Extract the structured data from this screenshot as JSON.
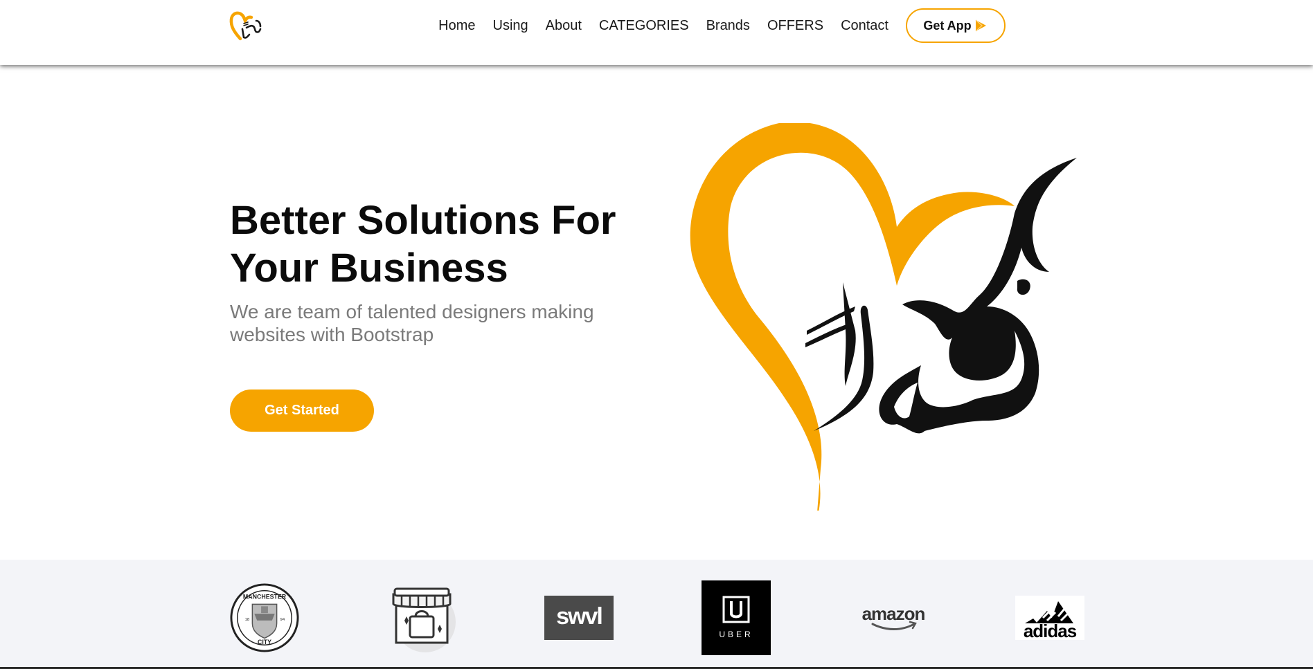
{
  "header": {
    "logo_icon": "heart-calligraphy-logo",
    "nav": [
      {
        "label": "Home"
      },
      {
        "label": "Using"
      },
      {
        "label": "About"
      },
      {
        "label": "CATEGORIES"
      },
      {
        "label": "Brands"
      },
      {
        "label": "OFFERS"
      },
      {
        "label": "Contact"
      }
    ],
    "get_app_label": "Get App",
    "get_app_icon": "play-store-icon"
  },
  "hero": {
    "title": "Better Solutions For Your Business",
    "subtitle": "We are team of talented designers making websites with Bootstrap",
    "cta_label": "Get Started",
    "art_icon": "heart-shukran-calligraphy"
  },
  "clients": {
    "logos": [
      {
        "name": "manchester-city-logo",
        "text_top": "MANCHESTER",
        "text_bottom": "CITY"
      },
      {
        "name": "shop-bag-icon"
      },
      {
        "name": "swvl-logo",
        "text": "swvl"
      },
      {
        "name": "uber-logo",
        "text": "UBER"
      },
      {
        "name": "amazon-logo",
        "text": "amazon"
      },
      {
        "name": "adidas-logo",
        "text": "adidas"
      }
    ]
  },
  "colors": {
    "accent": "#f6a400",
    "text_dark": "#0b0b0b",
    "text_muted": "#7a7a7a",
    "clients_bg": "#f3f4f8"
  }
}
